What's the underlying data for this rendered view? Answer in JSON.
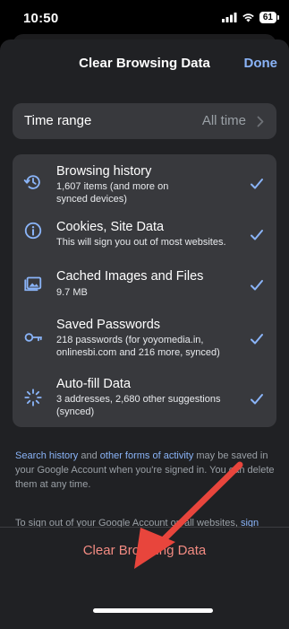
{
  "status": {
    "time": "10:50",
    "battery": "61"
  },
  "header": {
    "title": "Clear Browsing Data",
    "done_label": "Done"
  },
  "time_range": {
    "label": "Time range",
    "value": "All time"
  },
  "items": [
    {
      "title": "Browsing history",
      "subtitle": "1,607 items (and more on synced devices)",
      "icon": "history-icon",
      "checked": true
    },
    {
      "title": "Cookies, Site Data",
      "subtitle": "This will sign you out of most websites.",
      "icon": "info-icon",
      "checked": true
    },
    {
      "title": "Cached Images and Files",
      "subtitle": "9.7 MB",
      "icon": "images-icon",
      "checked": true
    },
    {
      "title": "Saved Passwords",
      "subtitle": "218 passwords (for yoyomedia.in, onlinesbi.com and 216 more, synced)",
      "icon": "key-icon",
      "checked": true
    },
    {
      "title": "Auto-fill Data",
      "subtitle": "3 addresses, 2,680 other suggestions (synced)",
      "icon": "autofill-icon",
      "checked": true
    }
  ],
  "footer": {
    "p1_link1": "Search history",
    "p1_and": " and ",
    "p1_link2": "other forms of activity",
    "p1_text": " may be saved in your Google Account when you're signed in. You can delete them at any time.",
    "p2_text": "To sign out of your Google Account on all websites, ",
    "p2_link": "sign out of Chrome",
    "p2_end": "."
  },
  "action": {
    "clear_label": "Clear Browsing Data"
  },
  "colors": {
    "accent": "#8ab4f8",
    "danger": "#f28b82",
    "annotation_arrow": "#e8453c"
  }
}
